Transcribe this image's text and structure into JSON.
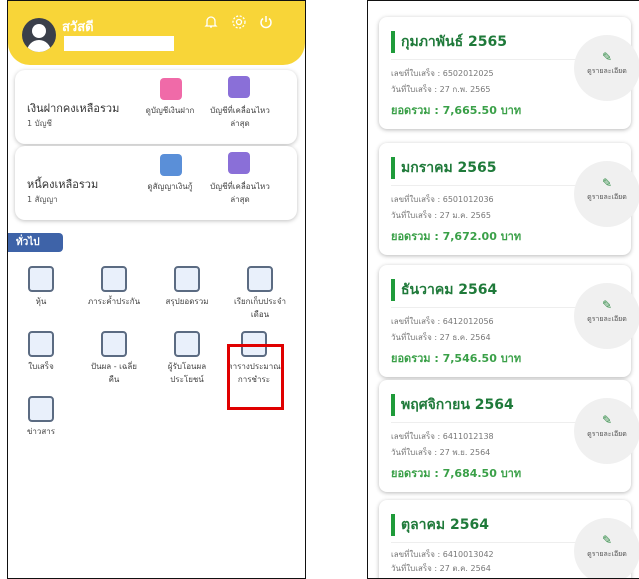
{
  "left": {
    "greeting": "สวัสดี",
    "header_icons": [
      "bell-icon",
      "gear-icon",
      "power-icon"
    ],
    "deposit": {
      "title": "เงินฝากคงเหลือรวม",
      "count": "1 บัญชี",
      "btn1": "ดูบัญชีเงินฝาก",
      "btn2a": "บัญชีที่เคลื่อนไหว",
      "btn2b": "ล่าสุด"
    },
    "loan": {
      "title": "หนี้คงเหลือรวม",
      "count": "1 สัญญา",
      "btn1": "ดูสัญญาเงินกู้",
      "btn2a": "บัญชีที่เคลื่อนไหว",
      "btn2b": "ล่าสุด"
    },
    "section_label": "ทั่วไป",
    "grid": [
      {
        "l1": "หุ้น",
        "l2": ""
      },
      {
        "l1": "ภาระค้ำประกัน",
        "l2": ""
      },
      {
        "l1": "สรุปยอดรวม",
        "l2": ""
      },
      {
        "l1": "เรียกเก็บประจำ",
        "l2": "เดือน"
      },
      {
        "l1": "ใบเสร็จ",
        "l2": ""
      },
      {
        "l1": "ปันผล - เฉลี่ย",
        "l2": "คืน"
      },
      {
        "l1": "ผู้รับโอนผล",
        "l2": "ประโยชน์"
      },
      {
        "l1": "ตารางประมาณ",
        "l2": "การชำระ"
      },
      {
        "l1": "ข่าวสาร",
        "l2": ""
      }
    ]
  },
  "right": {
    "detail_label": "ดูรายละเอียด",
    "receipts": [
      {
        "month": "กุมภาพันธ์ 2565",
        "no": "เลขที่ใบเสร็จ : 6502012025",
        "date": "วันที่ใบเสร็จ : 27 ก.พ. 2565",
        "total": "ยอดรวม : 7,665.50 บาท"
      },
      {
        "month": "มกราคม 2565",
        "no": "เลขที่ใบเสร็จ : 6501012036",
        "date": "วันที่ใบเสร็จ : 27 ม.ค. 2565",
        "total": "ยอดรวม : 7,672.00 บาท"
      },
      {
        "month": "ธันวาคม 2564",
        "no": "เลขที่ใบเสร็จ : 6412012056",
        "date": "วันที่ใบเสร็จ : 27 ธ.ค. 2564",
        "total": "ยอดรวม : 7,546.50 บาท"
      },
      {
        "month": "พฤศจิกายน 2564",
        "no": "เลขที่ใบเสร็จ : 6411012138",
        "date": "วันที่ใบเสร็จ : 27 พ.ย. 2564",
        "total": "ยอดรวม : 7,684.50 บาท"
      },
      {
        "month": "ตุลาคม 2564",
        "no": "เลขที่ใบเสร็จ : 6410013042",
        "date": "วันที่ใบเสร็จ : 27 ต.ค. 2564",
        "total": ""
      }
    ]
  }
}
